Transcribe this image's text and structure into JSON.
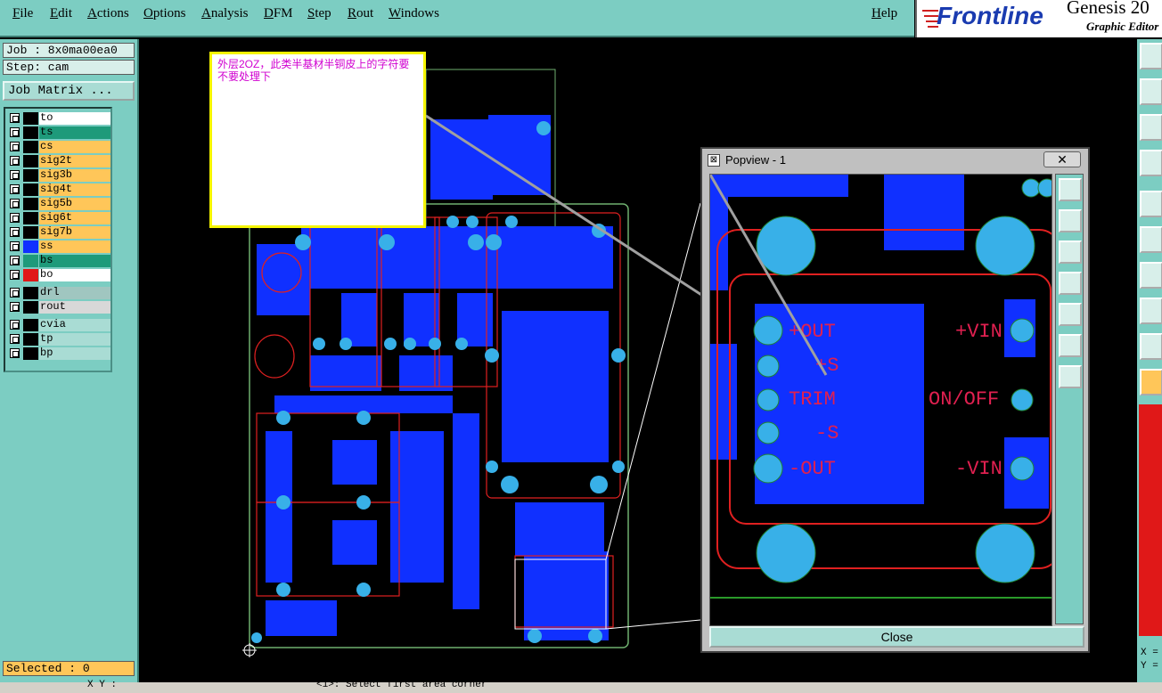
{
  "menu": [
    "File",
    "Edit",
    "Actions",
    "Options",
    "Analysis",
    "DFM",
    "Step",
    "Rout",
    "Windows"
  ],
  "help": "Help",
  "brand": {
    "logo": "Frontline",
    "product": "Genesis 20",
    "subtitle": "Graphic Editor"
  },
  "job_label": "Job : 8x0ma00ea0",
  "step_label": "Step: cam",
  "job_matrix": "Job Matrix ...",
  "layers": [
    {
      "name": "to",
      "color": "#ffffff"
    },
    {
      "name": "ts",
      "color": "#1e9a7a"
    },
    {
      "name": "cs",
      "color": "#ffc659"
    },
    {
      "name": "sig2t",
      "color": "#ffc659"
    },
    {
      "name": "sig3b",
      "color": "#ffc659"
    },
    {
      "name": "sig4t",
      "color": "#ffc659"
    },
    {
      "name": "sig5b",
      "color": "#ffc659"
    },
    {
      "name": "sig6t",
      "color": "#ffc659"
    },
    {
      "name": "sig7b",
      "color": "#ffc659"
    },
    {
      "name": "ss",
      "color": "#ffc659"
    },
    {
      "name": "bs",
      "color": "#1e9a7a"
    },
    {
      "name": "bo",
      "color": "#ffffff"
    },
    {
      "name": "drl",
      "color": "#a0c6c0"
    },
    {
      "name": "rout",
      "color": "#d8d8d8"
    },
    {
      "name": "cvia",
      "color": "#a9dcd4"
    },
    {
      "name": "tp",
      "color": "#a9dcd4"
    },
    {
      "name": "bp",
      "color": "#a9dcd4"
    }
  ],
  "selected": "Selected : 0",
  "note": "外层2OZ，此类半基材半铜皮上的字符要不要处理下",
  "popview": {
    "title": "Popview - 1",
    "close_x": "✕",
    "close_button": "Close",
    "silk": [
      "+OUT",
      "+S",
      "TRIM",
      "-S",
      "-OUT",
      "+VIN",
      "ON/OFF",
      "-VIN"
    ]
  },
  "status": {
    "xy": "X Y :",
    "prompt": "<1>: Select first area corner"
  },
  "coords": {
    "x": "X =",
    "y": "Y ="
  }
}
